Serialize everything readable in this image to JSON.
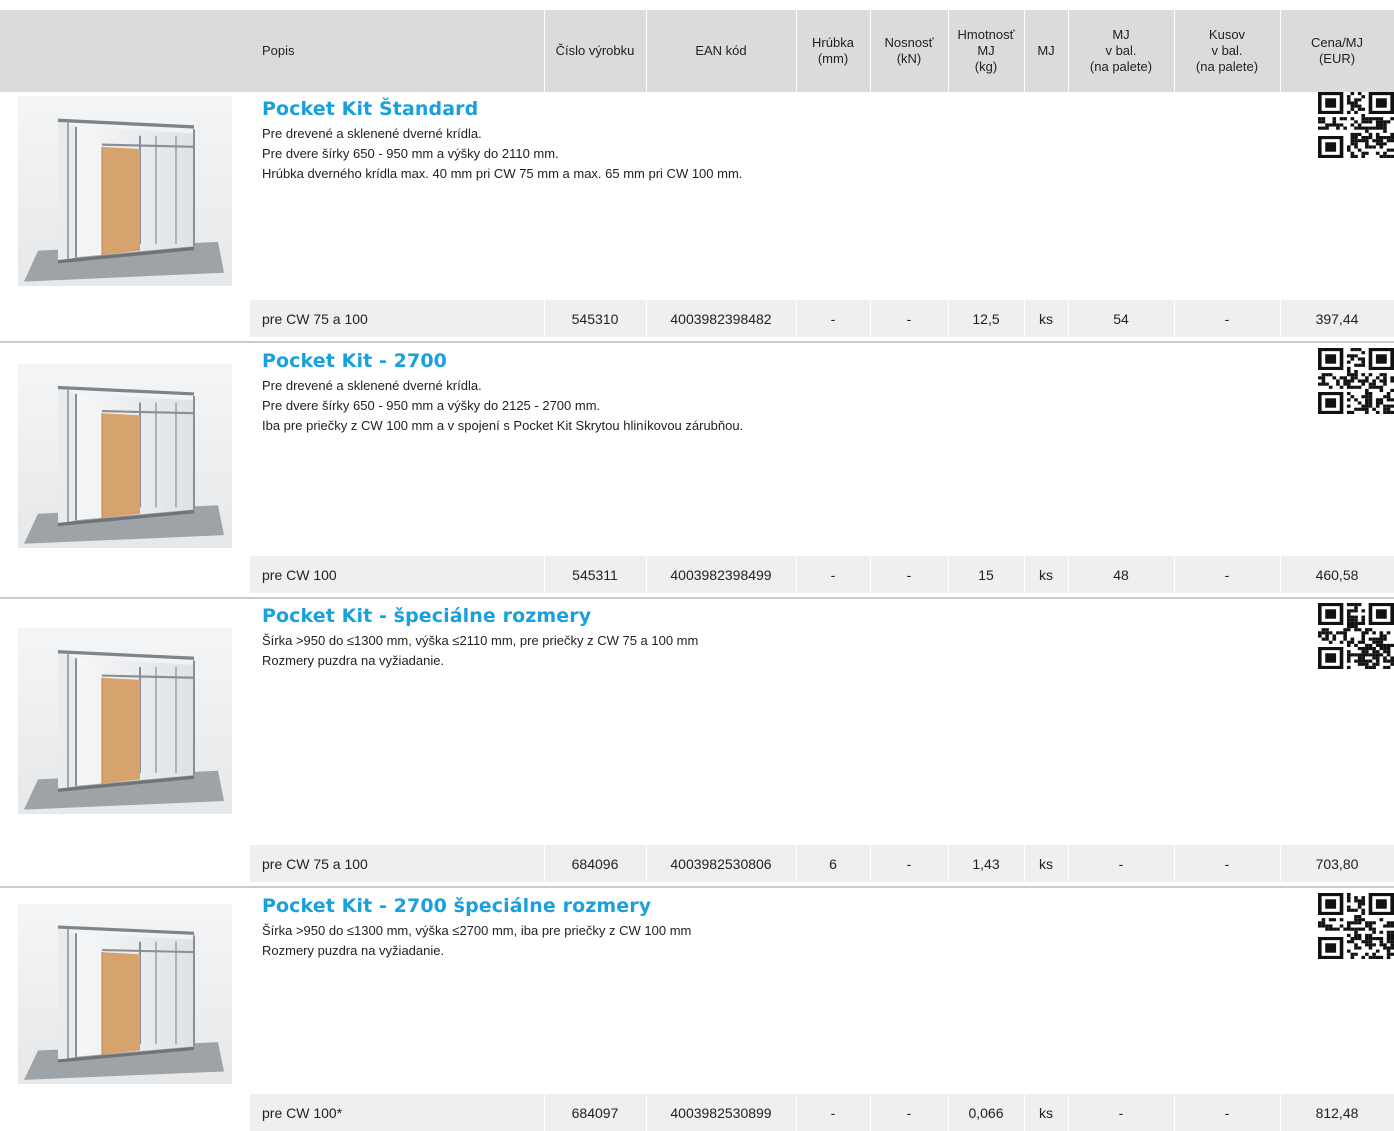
{
  "columns": [
    {
      "key": "popis",
      "label": "Popis"
    },
    {
      "key": "cislo",
      "label": "Číslo výrobku"
    },
    {
      "key": "ean",
      "label": "EAN kód"
    },
    {
      "key": "hrubka",
      "label": "Hrúbka\n(mm)"
    },
    {
      "key": "nosnost",
      "label": "Nosnosť\n(kN)"
    },
    {
      "key": "hmotnost",
      "label": "Hmotnosť\nMJ\n(kg)"
    },
    {
      "key": "mj",
      "label": "MJ"
    },
    {
      "key": "mj_bal",
      "label": "MJ\nv bal.\n(na palete)"
    },
    {
      "key": "kusov",
      "label": "Kusov\nv bal.\n(na palete)"
    },
    {
      "key": "cena",
      "label": "Cena/MJ\n(EUR)"
    }
  ],
  "products": [
    {
      "title": "Pocket Kit Štandard",
      "lines": [
        "Pre drevené a sklenené dverné krídla.",
        "Pre dvere šírky 650 - 950 mm a výšky do 2110 mm.",
        "Hrúbka dverného krídla max. 40 mm pri CW 75 mm a max. 65 mm pri CW 100 mm."
      ],
      "row": {
        "popis": "pre CW 75 a 100",
        "cislo": "545310",
        "ean": "4003982398482",
        "hrubka": "-",
        "nosnost": "-",
        "hmotnost": "12,5",
        "mj": "ks",
        "mj_bal": "54",
        "kusov": "-",
        "cena": "397,44"
      }
    },
    {
      "title": "Pocket Kit - 2700",
      "lines": [
        "Pre drevené a sklenené dverné krídla.",
        "Pre dvere šírky 650 - 950 mm a výšky do 2125 - 2700 mm.",
        "Iba pre priečky z CW 100 mm a v spojení s Pocket Kit Skrytou hliníkovou zárubňou."
      ],
      "row": {
        "popis": "pre CW 100",
        "cislo": "545311",
        "ean": "4003982398499",
        "hrubka": "-",
        "nosnost": "-",
        "hmotnost": "15",
        "mj": "ks",
        "mj_bal": "48",
        "kusov": "-",
        "cena": "460,58"
      }
    },
    {
      "title": "Pocket Kit - špeciálne rozmery",
      "lines": [
        "Šírka >950 do ≤1300 mm, výška ≤2110 mm, pre priečky z CW 75 a 100 mm",
        "Rozmery puzdra na vyžiadanie."
      ],
      "row": {
        "popis": "pre CW 75 a 100",
        "cislo": "684096",
        "ean": "4003982530806",
        "hrubka": "6",
        "nosnost": "-",
        "hmotnost": "1,43",
        "mj": "ks",
        "mj_bal": "-",
        "kusov": "-",
        "cena": "703,80"
      }
    },
    {
      "title": "Pocket Kit - 2700 špeciálne rozmery",
      "lines": [
        "Šírka >950 do ≤1300 mm, výška ≤2700 mm, iba pre priečky z CW 100 mm",
        "Rozmery puzdra na vyžiadanie."
      ],
      "row": {
        "popis": "pre CW 100*",
        "cislo": "684097",
        "ean": "4003982530899",
        "hrubka": "-",
        "nosnost": "-",
        "hmotnost": "0,066",
        "mj": "ks",
        "mj_bal": "-",
        "kusov": "-",
        "cena": "812,48"
      }
    }
  ],
  "colors": {
    "title": "#1aa0dc",
    "header_bg": "#d9dbdd",
    "row_bg": "#eeeff0",
    "divider": "#c9cbce"
  },
  "icons": {
    "qr": "qr-code-icon",
    "product": "pocket-kit-product-image"
  }
}
